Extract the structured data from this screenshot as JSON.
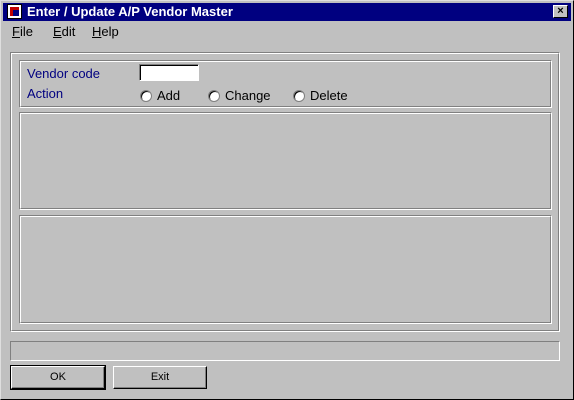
{
  "window": {
    "title": "Enter / Update A/P Vendor Master",
    "close_glyph": "×"
  },
  "menu": {
    "items": [
      "File",
      "Edit",
      "Help"
    ]
  },
  "form": {
    "vendor_code_label": "Vendor code",
    "vendor_code_value": "",
    "action_label": "Action",
    "actions": [
      "Add",
      "Change",
      "Delete"
    ],
    "selected_action": null
  },
  "status_text": "",
  "buttons": {
    "ok_label": "OK",
    "exit_label": "Exit"
  },
  "colors": {
    "titlebar": "#000080",
    "label_text": "#000080",
    "face": "#c0c0c0"
  }
}
